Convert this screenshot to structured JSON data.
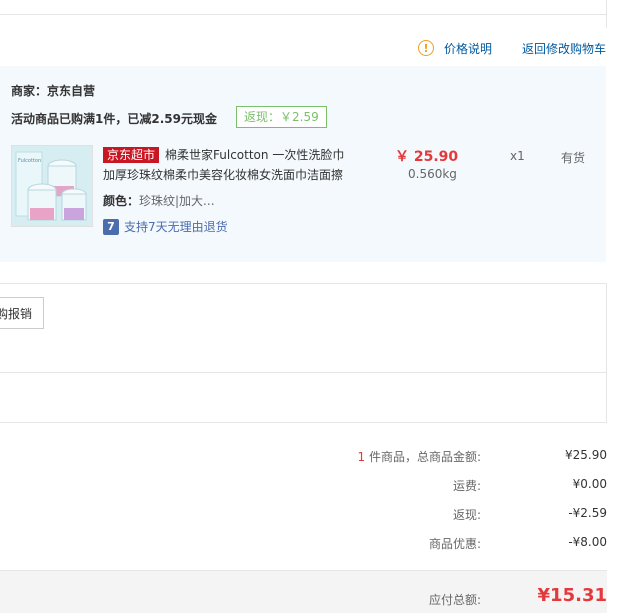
{
  "top_links": {
    "price_info_label": "价格说明",
    "back_to_cart_label": "返回修改购物车"
  },
  "shop": {
    "merchant_label": "商家：京东自营",
    "promo_text": "活动商品已购满1件，已减2.59元现金",
    "rebate_badge": "返现：￥2.59"
  },
  "product": {
    "store_badge": "京东超市",
    "title": "棉柔世家Fulcotton 一次性洗脸巾 加厚珍珠纹棉柔巾美容化妆棉女洗面巾洁面擦",
    "attr_label": "颜色：",
    "attr_value": "珍珠纹|加大...",
    "return_icon_text": "7",
    "return_policy": "支持7天无理由退货",
    "price": "￥ 25.90",
    "weight": "0.560kg",
    "quantity": "x1",
    "stock_status": "有货"
  },
  "invoice": {
    "button_label": "购报销"
  },
  "summary": {
    "count": "1",
    "goods_total_label": " 件商品，总商品金额:",
    "goods_total_value": "¥25.90",
    "shipping_label": "运费:",
    "shipping_value": "¥0.00",
    "rebate_label": "返现:",
    "rebate_value": "-¥2.59",
    "discount_label": "商品优惠:",
    "discount_value": "-¥8.00",
    "payable_label": "应付总额:",
    "payable_value": "¥15.31"
  },
  "colors": {
    "accent_red": "#e4393c",
    "link_blue": "#005aa0",
    "rebate_green": "#7abf6a",
    "shop_bg": "#f3f9fd"
  }
}
